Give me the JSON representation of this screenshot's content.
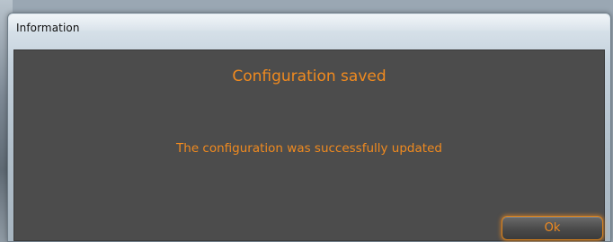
{
  "window": {
    "title": "Information"
  },
  "dialog": {
    "heading": "Configuration saved",
    "message": "The configuration was successfully updated",
    "ok_label": "Ok"
  },
  "colors": {
    "accent": "#f08a1f",
    "panel_background": "#4c4c4c"
  }
}
